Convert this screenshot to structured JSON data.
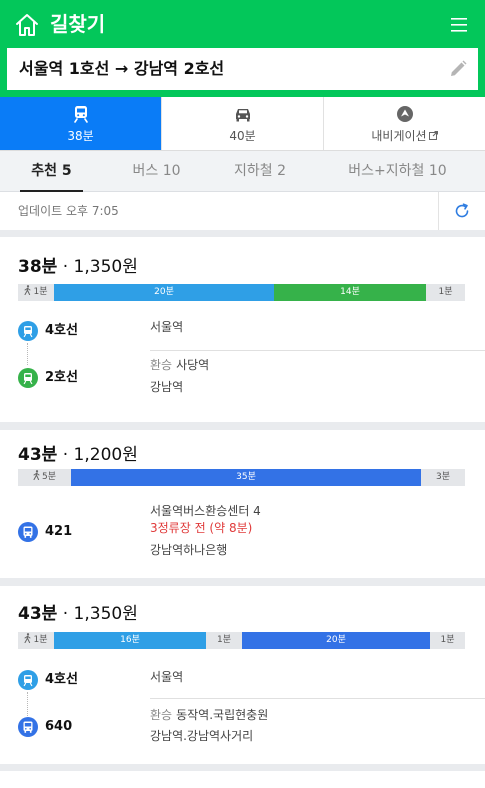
{
  "header": {
    "title": "길찾기",
    "route_text": "서울역 1호선 → 강남역 2호선",
    "colors": {
      "brand": "#03c75a"
    }
  },
  "modes": [
    {
      "icon": "subway-icon",
      "label": "38분",
      "active": true
    },
    {
      "icon": "car-icon",
      "label": "40분",
      "active": false
    },
    {
      "icon": "navigation-icon",
      "label": "내비게이션",
      "active": false
    }
  ],
  "tabs": [
    {
      "label": "추천 5",
      "active": true
    },
    {
      "label": "버스 10",
      "active": false
    },
    {
      "label": "지하철 2",
      "active": false
    },
    {
      "label": "버스+지하철 10",
      "active": false
    }
  ],
  "update": {
    "text": "업데이트 오후 7:05"
  },
  "routes": [
    {
      "time": "38분",
      "fare": "1,350원",
      "segments": [
        {
          "type": "walk",
          "label": "1분"
        },
        {
          "type": "subway-line4",
          "label": "20분"
        },
        {
          "type": "subway-line2",
          "label": "14분"
        },
        {
          "type": "walk",
          "label": "1분"
        }
      ],
      "legs": [
        {
          "icon": "subway-icon",
          "name": "4호선",
          "color": "#2f9fe6"
        },
        {
          "icon": "subway-icon",
          "name": "2호선",
          "color": "#36b24a"
        }
      ],
      "stops": {
        "start": "서울역",
        "transfer_label": "환승",
        "transfer": "사당역",
        "end": "강남역"
      }
    },
    {
      "time": "43분",
      "fare": "1,200원",
      "segments": [
        {
          "type": "walk",
          "label": "5분"
        },
        {
          "type": "bus",
          "label": "35분"
        },
        {
          "type": "walk",
          "label": "3분"
        }
      ],
      "legs": [
        {
          "icon": "bus-icon",
          "name": "421",
          "color": "#3372e6"
        }
      ],
      "stops": {
        "start": "서울역버스환승센터 4",
        "arrival": "3정류장 전 (약 8분)",
        "end": "강남역하나은행"
      }
    },
    {
      "time": "43분",
      "fare": "1,350원",
      "segments": [
        {
          "type": "walk",
          "label": "1분"
        },
        {
          "type": "subway-line4",
          "label": "16분"
        },
        {
          "type": "walk",
          "label": "1분"
        },
        {
          "type": "bus",
          "label": "20분"
        },
        {
          "type": "walk",
          "label": "1분"
        }
      ],
      "legs": [
        {
          "icon": "subway-icon",
          "name": "4호선",
          "color": "#2f9fe6"
        },
        {
          "icon": "bus-icon",
          "name": "640",
          "color": "#3372e6"
        }
      ],
      "stops": {
        "start": "서울역",
        "transfer_label": "환승",
        "transfer": "동작역.국립현충원",
        "end": "강남역.강남역사거리"
      }
    }
  ]
}
